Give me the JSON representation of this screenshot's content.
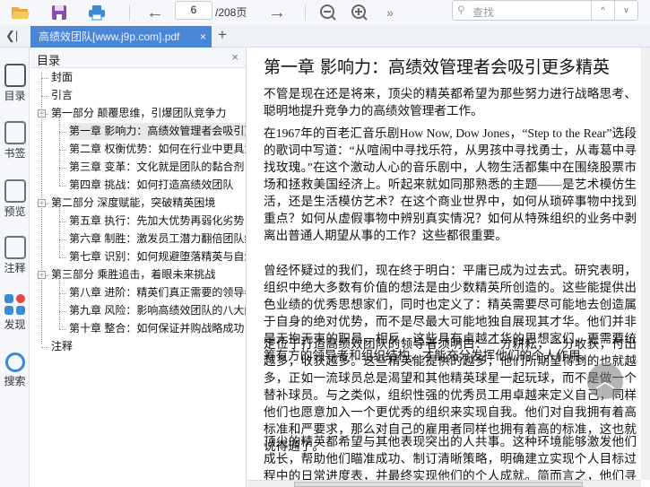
{
  "toolbar": {
    "current_page": "6",
    "total_pages": "/208页",
    "search_placeholder": "查找",
    "more": "»"
  },
  "tabs": [
    {
      "label": "高绩效团队[www.j9p.com].pdf",
      "close": "×"
    }
  ],
  "tab_add": "+",
  "collapse": "❮|",
  "rail": [
    {
      "label": "目录"
    },
    {
      "label": "书签"
    },
    {
      "label": "预览"
    },
    {
      "label": "注释"
    },
    {
      "label": "发现"
    },
    {
      "label": "搜索"
    }
  ],
  "toc": {
    "title": "目录",
    "close": "×",
    "items": [
      {
        "label": "封面",
        "level": 0
      },
      {
        "label": "引言",
        "level": 0
      },
      {
        "label": "第一部分 颠覆思维，引爆团队竞争力",
        "level": 0,
        "expanded": true
      },
      {
        "label": "第一章 影响力：高绩效管理者会吸引更多精英",
        "level": 1,
        "selected": true
      },
      {
        "label": "第二章 权衡优势：如何在行业中更具竞争力",
        "level": 1
      },
      {
        "label": "第三章 变革：文化就是团队的黏合剂",
        "level": 1
      },
      {
        "label": "第四章 挑战：如何打造高绩效团队",
        "level": 1
      },
      {
        "label": "第二部分 深度赋能，突破精英困境",
        "level": 0,
        "expanded": true
      },
      {
        "label": "第五章 执行：先加大优势再弱化劣势",
        "level": 1
      },
      {
        "label": "第六章 制胜：激发员工潜力翻倍团队绩效",
        "level": 1
      },
      {
        "label": "第七章 识别：如何规避堕落精英与自满精英",
        "level": 1
      },
      {
        "label": "第三部分 乘胜追击，着眼未来挑战",
        "level": 0,
        "expanded": true
      },
      {
        "label": "第八章 进阶：精英们真正需要的领导者",
        "level": 1
      },
      {
        "label": "第九章 风险：影响高绩效团队的八大问题",
        "level": 1
      },
      {
        "label": "第十章 整合：如何保证并购战略成功",
        "level": 1
      },
      {
        "label": "注释",
        "level": 0
      }
    ]
  },
  "document": {
    "title": "第一章 影响力：高绩效管理者会吸引更多精英",
    "paragraphs": [
      "不管是现在还是将来，顶尖的精英都希望为那些努力进行战略思考、聪明地提升竞争力的高绩效管理者工作。",
      "在1967年的百老汇音乐剧How Now, Dow Jones，“Step to the Rear”选段的歌词中写道：“从喧闹中寻找乐符，从男孩中寻找勇士，从毒葛中寻找玫瑰。”在这个激动人心的音乐剧中，人物生活都集中在围绕股票市场和拯救美国经济上。听起来就如同那熟悉的主题——是艺术模仿生活，还是生活模仿艺术？在这个商业世界中，如何从琐碎事物中找到重点？如何从虚假事物中辨别真实情况？如何从特殊组织的业务中剥离出普通人期望从事的工作？这些都很重要。",
      "曾经怀疑过的我们，现在终于明白：平庸已成为过去式。研究表明，组织中绝大多数有价值的想法是由少数精英所创造的。这些能提供出色业绩的优秀思想家们，同时也定义了：精英需要尽可能地去创造属于自身的绝对优势，而不是尽最大可能地独自展现其才华。他们并非是无拘无束的职员，相反，这些具有卓越才华的思想家们，更需要统筹有方的领导者和组织结构，才能充分发挥他们的个人作用。",
      "定位于打造高绩效团队的领导者须明白：一分耕耘，一分收获，付出越多，收获越多。这些精英能提供的越多，他们所期望得到的也就越多，正如一流球员总是渴望和其他精英球星一起玩球，而不是做一个替补球员。与之类似，组织性强的优秀员工用卓越来定义自己，同样他们也愿意加入一个更优秀的组织来实现自我。他们对自我拥有着高标准和严要求，那么对自己的雇用者同样也拥有着高的标准，这也就说得通了。",
      "顶尖的精英都希望与其他表现突出的人共事。这种环境能够激发他们成长，帮助他们瞄准成功、制订清晰策略，明确建立实现个人目标过程中的日常进度表，并最终实现他们的个人成就。简而言之，他们寻求有一"
    ]
  },
  "colors": {
    "accent": "#4a86d8"
  }
}
